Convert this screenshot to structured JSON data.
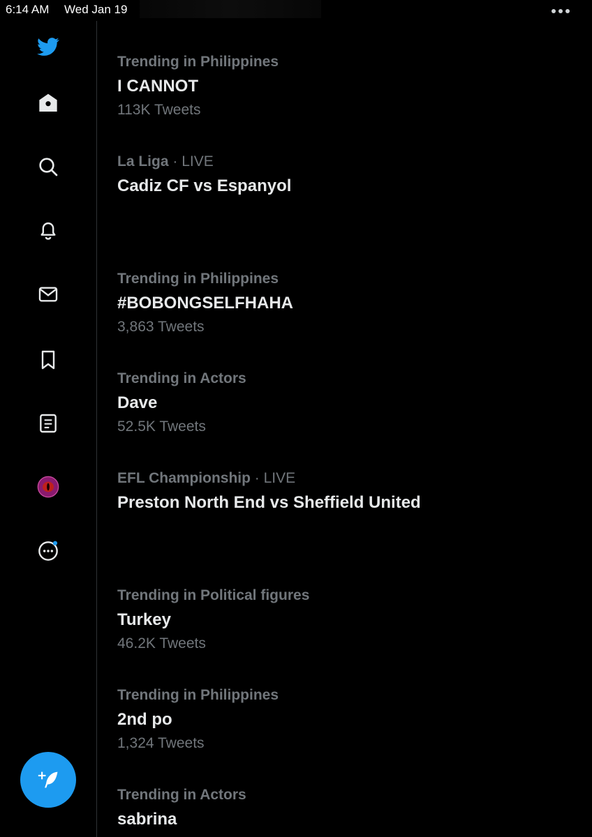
{
  "status_bar": {
    "time": "6:14 AM",
    "date": "Wed Jan 19"
  },
  "sidebar": {
    "items": [
      {
        "icon": "twitter-logo"
      },
      {
        "icon": "home-icon"
      },
      {
        "icon": "search-icon"
      },
      {
        "icon": "notifications-bell-icon"
      },
      {
        "icon": "messages-envelope-icon"
      },
      {
        "icon": "bookmark-icon"
      },
      {
        "icon": "lists-icon"
      },
      {
        "icon": "profile-avatar"
      },
      {
        "icon": "more-options-icon"
      }
    ],
    "compose_icon": "compose-tweet-icon",
    "accent_color": "#1d9bf0"
  },
  "trends": [
    {
      "context": "Trending in Philippines",
      "name": "I CANNOT",
      "count": "113K Tweets"
    },
    {
      "context": "La Liga",
      "live": "LIVE",
      "name": "Cadiz CF vs Espanyol"
    },
    {
      "context": "Trending in Philippines",
      "name": "#BOBONGSELFHAHA",
      "count": "3,863 Tweets"
    },
    {
      "context": "Trending in Actors",
      "name": "Dave",
      "count": "52.5K Tweets"
    },
    {
      "context": "EFL Championship",
      "live": "LIVE",
      "name": "Preston North End vs Sheffield United"
    },
    {
      "context": "Trending in Political figures",
      "name": "Turkey",
      "count": "46.2K Tweets"
    },
    {
      "context": "Trending in Philippines",
      "name": "2nd po",
      "count": "1,324 Tweets"
    },
    {
      "context": "Trending in Actors",
      "name": "sabrina"
    }
  ]
}
